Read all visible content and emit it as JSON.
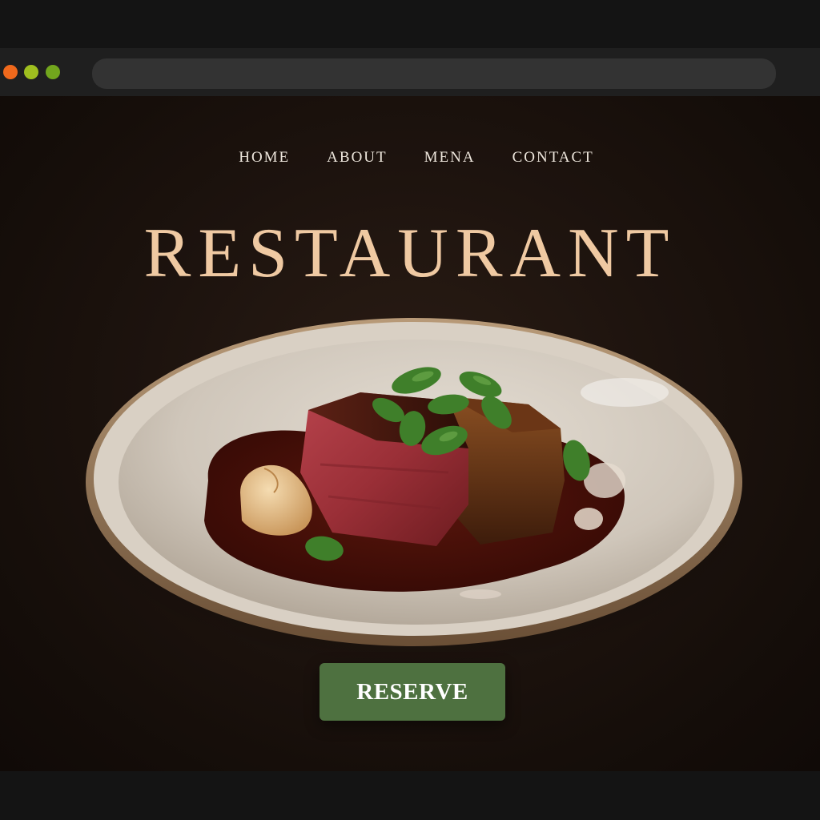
{
  "browser": {
    "window_controls": [
      {
        "name": "close",
        "color": "#f0691c"
      },
      {
        "name": "minimize",
        "color": "#9fbf1f"
      },
      {
        "name": "maximize",
        "color": "#72a61d"
      }
    ],
    "address_value": ""
  },
  "nav": {
    "items": [
      {
        "label": "HOME"
      },
      {
        "label": "ABOUT"
      },
      {
        "label": "MENA"
      },
      {
        "label": "CONTACT"
      }
    ]
  },
  "hero": {
    "title": "RESTAURANT",
    "image_subject": "plated-steak-with-sauce-and-herbs"
  },
  "cta": {
    "label": "RESERVE",
    "color": "#4e7140"
  },
  "colors": {
    "title": "#efc9a2",
    "nav_text": "#eee7dd",
    "background": "#1b120d"
  }
}
